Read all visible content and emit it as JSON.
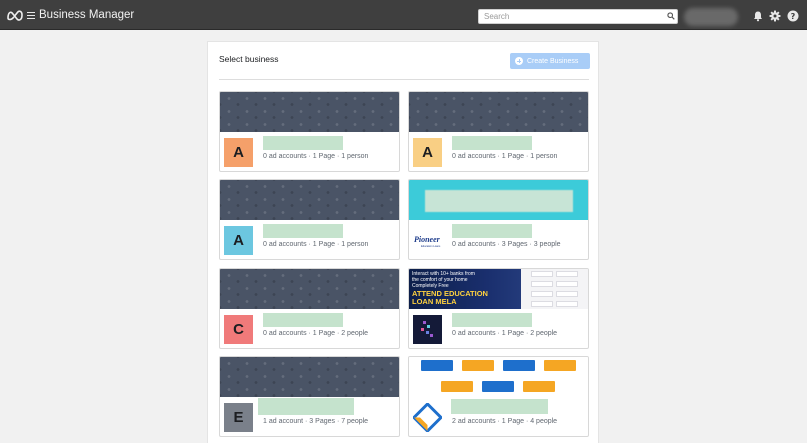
{
  "app": {
    "title": "Business Manager"
  },
  "search": {
    "placeholder": "Search"
  },
  "icons": {
    "logo": "meta-logo",
    "menu": "hamburger-icon",
    "search": "search-icon",
    "notifications": "bell-icon",
    "settings": "gear-icon",
    "help": "help-icon"
  },
  "panel": {
    "title": "Select business",
    "create_button": "Create Business"
  },
  "colors": {
    "topbar": "#3f3f3f",
    "create_button": "#a9cdf7",
    "blurred_name": "#c5e3cd"
  },
  "banner": {
    "line1": "Interact with 10+ banks from",
    "line2": "the comfort of your home",
    "line3": "Completely Free",
    "line4": "ATTEND EDUCATION",
    "line5": "LOAN MELA"
  },
  "businesses": [
    {
      "initial": "A",
      "avatar_color": "#f5a06a",
      "stats": "0 ad accounts · 1 Page · 1 person"
    },
    {
      "initial": "A",
      "avatar_color": "#f9cf84",
      "stats": "0 ad accounts · 1 Page · 1 person"
    },
    {
      "initial": "A",
      "avatar_color": "#6cc7e0",
      "stats": "0 ad accounts · 1 Page · 1 person"
    },
    {
      "logo_text": "Pioneer",
      "logo_subtext": "Education Loans",
      "stats": "0 ad accounts · 3 Pages · 3 people"
    },
    {
      "initial": "C",
      "avatar_color": "#f07a7a",
      "stats": "0 ad accounts · 1 Page · 2 people"
    },
    {
      "stats": "0 ad accounts · 1 Page · 2 people"
    },
    {
      "initial": "E",
      "avatar_color": "#7a808a",
      "stats": "1 ad account · 3 Pages · 7 people"
    },
    {
      "stats": "2 ad accounts · 1 Page · 4 people"
    }
  ]
}
